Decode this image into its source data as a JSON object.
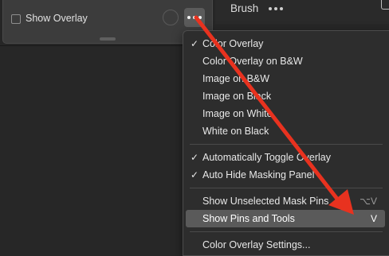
{
  "mask_panel": {
    "checkbox_label": "Show Overlay",
    "checkbox_checked": false
  },
  "brush_panel": {
    "title": "Brush"
  },
  "menu": {
    "group1": [
      {
        "label": "Color Overlay",
        "checked": true
      },
      {
        "label": "Color Overlay on B&W",
        "checked": false
      },
      {
        "label": "Image on B&W",
        "checked": false
      },
      {
        "label": "Image on Black",
        "checked": false
      },
      {
        "label": "Image on White",
        "checked": false
      },
      {
        "label": "White on Black",
        "checked": false
      }
    ],
    "group2": [
      {
        "label": "Automatically Toggle Overlay",
        "checked": true
      },
      {
        "label": "Auto Hide Masking Panel",
        "checked": true
      }
    ],
    "group3": [
      {
        "label": "Show Unselected Mask Pins",
        "shortcut": "⌥V",
        "highlighted": false
      },
      {
        "label": "Show Pins and Tools",
        "shortcut": "V",
        "highlighted": true
      }
    ],
    "group4": [
      {
        "label": "Color Overlay Settings..."
      }
    ],
    "check_glyph": "✓"
  },
  "colors": {
    "annotation_arrow": "#e8321f",
    "menu_highlight": "#5a5a5a"
  }
}
